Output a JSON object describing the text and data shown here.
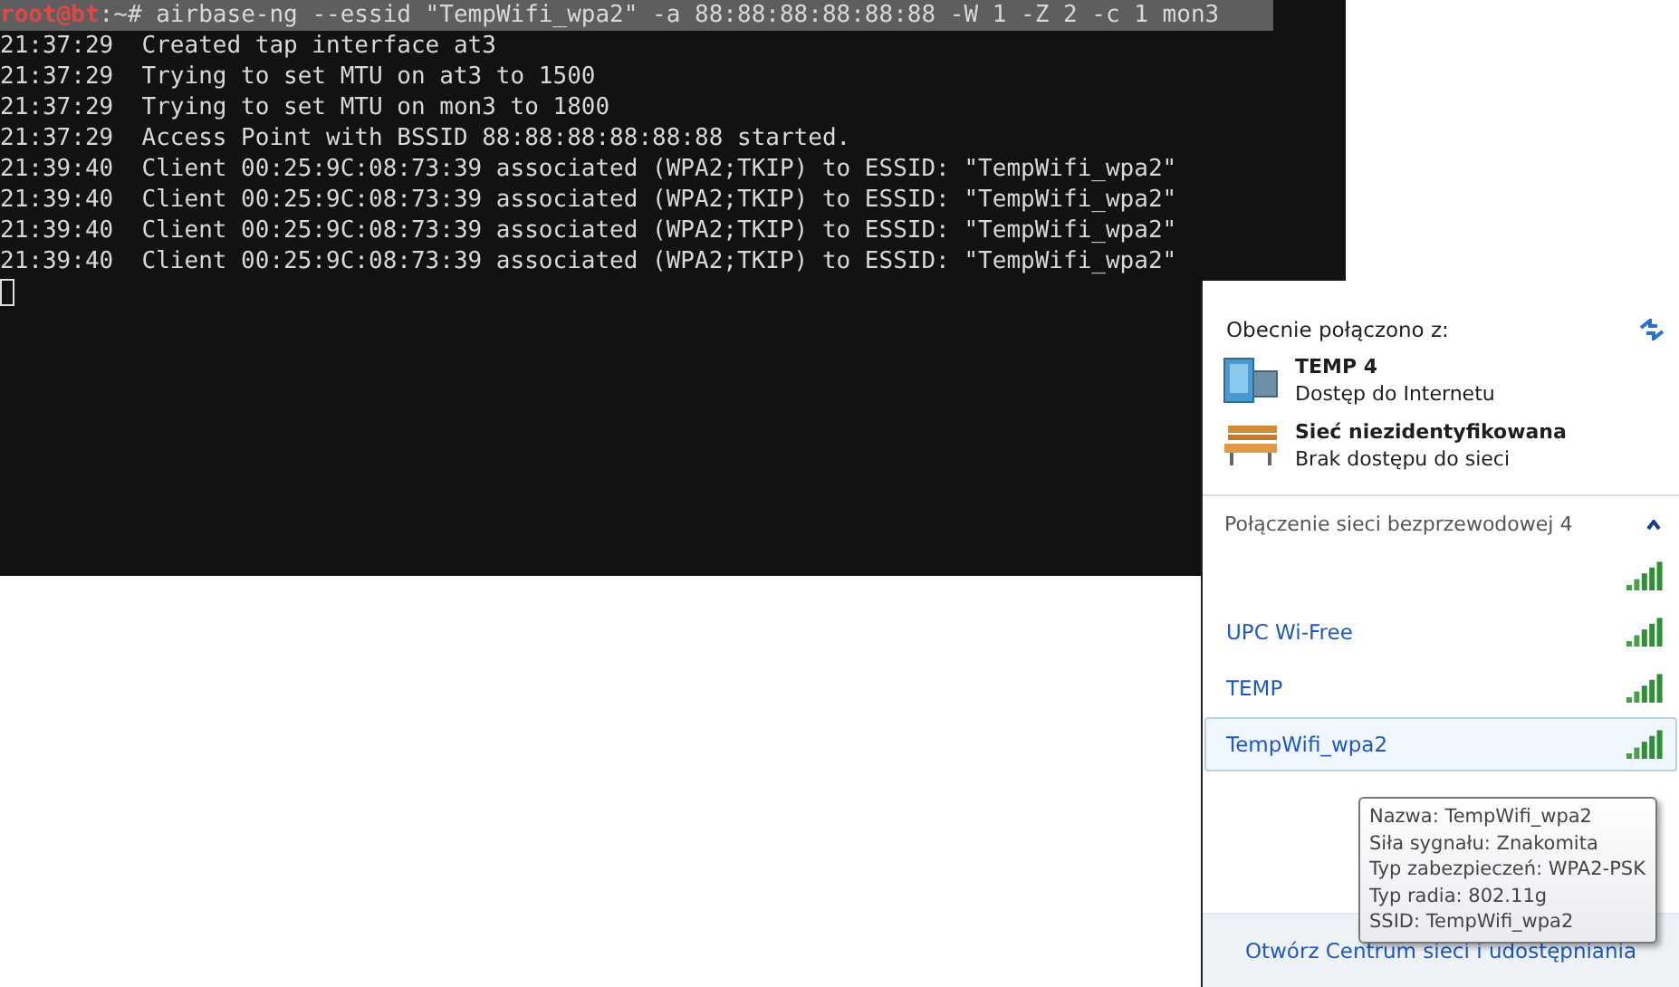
{
  "terminal": {
    "prompt_user": "root@bt",
    "prompt_rest": ":~# airbase-ng --essid \"TempWifi_wpa2\" -a 88:88:88:88:88:88 -W 1 -Z 2 -c 1 mon3",
    "lines": [
      {
        "time": "21:37:29",
        "message": "Created tap interface at3"
      },
      {
        "time": "21:37:29",
        "message": "Trying to set MTU on at3 to 1500"
      },
      {
        "time": "21:37:29",
        "message": "Trying to set MTU on mon3 to 1800"
      },
      {
        "time": "21:37:29",
        "message": "Access Point with BSSID 88:88:88:88:88:88 started."
      },
      {
        "time": "21:39:40",
        "message": "Client 00:25:9C:08:73:39 associated (WPA2;TKIP) to ESSID: \"TempWifi_wpa2\""
      },
      {
        "time": "21:39:40",
        "message": "Client 00:25:9C:08:73:39 associated (WPA2;TKIP) to ESSID: \"TempWifi_wpa2\""
      },
      {
        "time": "21:39:40",
        "message": "Client 00:25:9C:08:73:39 associated (WPA2;TKIP) to ESSID: \"TempWifi_wpa2\""
      },
      {
        "time": "21:39:40",
        "message": "Client 00:25:9C:08:73:39 associated (WPA2;TKIP) to ESSID: \"TempWifi_wpa2\""
      }
    ]
  },
  "network_panel": {
    "heading": "Obecnie połączono z:",
    "connections": [
      {
        "kind": "internet",
        "name": "TEMP  4",
        "status": "Dostęp do Internetu"
      },
      {
        "kind": "unidentified",
        "name": "Sieć niezidentyfikowana",
        "status": "Brak dostępu do sieci"
      }
    ],
    "section": {
      "title": "Połączenie sieci bezprzewodowej 4",
      "expanded": true
    },
    "networks": [
      {
        "selected": false
      },
      {
        "name": "UPC Wi-Free",
        "selected": false
      },
      {
        "name": "TEMP",
        "selected": false
      },
      {
        "name": "TempWifi_wpa2",
        "selected": true
      }
    ],
    "tooltip": [
      "Nazwa: TempWifi_wpa2",
      "Siła sygnału: Znakomita",
      "Typ zabezpieczeń: WPA2-PSK",
      "Typ radia: 802.11g",
      "SSID: TempWifi_wpa2"
    ],
    "footer_link": "Otwórz Centrum sieci i udostępniania"
  }
}
